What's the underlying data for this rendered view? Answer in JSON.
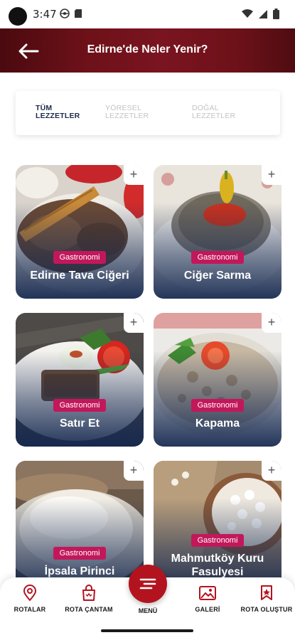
{
  "status_bar": {
    "time": "3:47"
  },
  "header": {
    "title": "Edirne'de Neler Yenir?"
  },
  "tabs": [
    {
      "line1": "TÜM",
      "line2": "LEZZETLER",
      "active": true
    },
    {
      "line1": "YÖRESEL",
      "line2": "LEZZETLER",
      "active": false
    },
    {
      "line1": "DOĞAL",
      "line2": "LEZZETLER",
      "active": false
    }
  ],
  "cards": [
    {
      "title": "Edirne Tava Ciğeri",
      "badge": "Gastronomi",
      "add": "+"
    },
    {
      "title": "Ciğer Sarma",
      "badge": "Gastronomi",
      "add": "+"
    },
    {
      "title": "Satır Et",
      "badge": "Gastronomi",
      "add": "+"
    },
    {
      "title": "Kapama",
      "badge": "Gastronomi",
      "add": "+"
    },
    {
      "title": "İpsala Pirinci",
      "badge": "Gastronomi",
      "add": "+"
    },
    {
      "title": "Mahmutköy Kuru Fasulyesi",
      "badge": "Gastronomi",
      "add": "+"
    }
  ],
  "bottom_nav": {
    "routes": "ROTALAR",
    "bag": "ROTA ÇANTAM",
    "menu": "MENÜ",
    "gallery": "GALERİ",
    "create": "ROTA OLUŞTUR"
  },
  "colors": {
    "header": "#6e1119",
    "badge": "#c2185b",
    "fab": "#b3131f",
    "tab_active": "#1d2a4d"
  }
}
